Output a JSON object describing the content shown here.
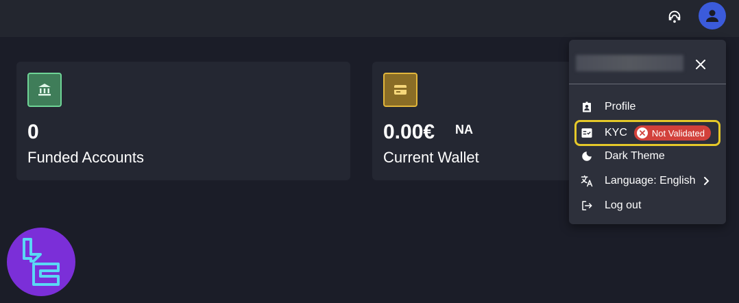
{
  "header": {
    "support_icon": "headset-icon",
    "avatar_icon": "person-icon",
    "avatar_color": "#3b5bdb"
  },
  "cards": [
    {
      "icon": "bank-icon",
      "value": "0",
      "suffix": "",
      "label": "Funded Accounts",
      "accent": "#6fd597"
    },
    {
      "icon": "wallet-icon",
      "value": "0.00€",
      "suffix": "NA",
      "label": "Current Wallet",
      "accent": "#e3b73c"
    }
  ],
  "user_menu": {
    "close_icon": "close-icon",
    "items": [
      {
        "label": "Profile",
        "icon": "badge-id-icon"
      },
      {
        "label": "KYC",
        "icon": "checklist-icon",
        "badge": "Not Validated",
        "badge_color": "#d2413b",
        "highlight_color": "#e6c929"
      },
      {
        "label": "Dark Theme",
        "icon": "moon-icon"
      },
      {
        "label": "Language: English",
        "icon": "translate-icon"
      },
      {
        "label": "Log out",
        "icon": "logout-icon"
      }
    ]
  },
  "logo": {
    "icon": "brand-logo-icon",
    "color": "#7b2fd8"
  }
}
